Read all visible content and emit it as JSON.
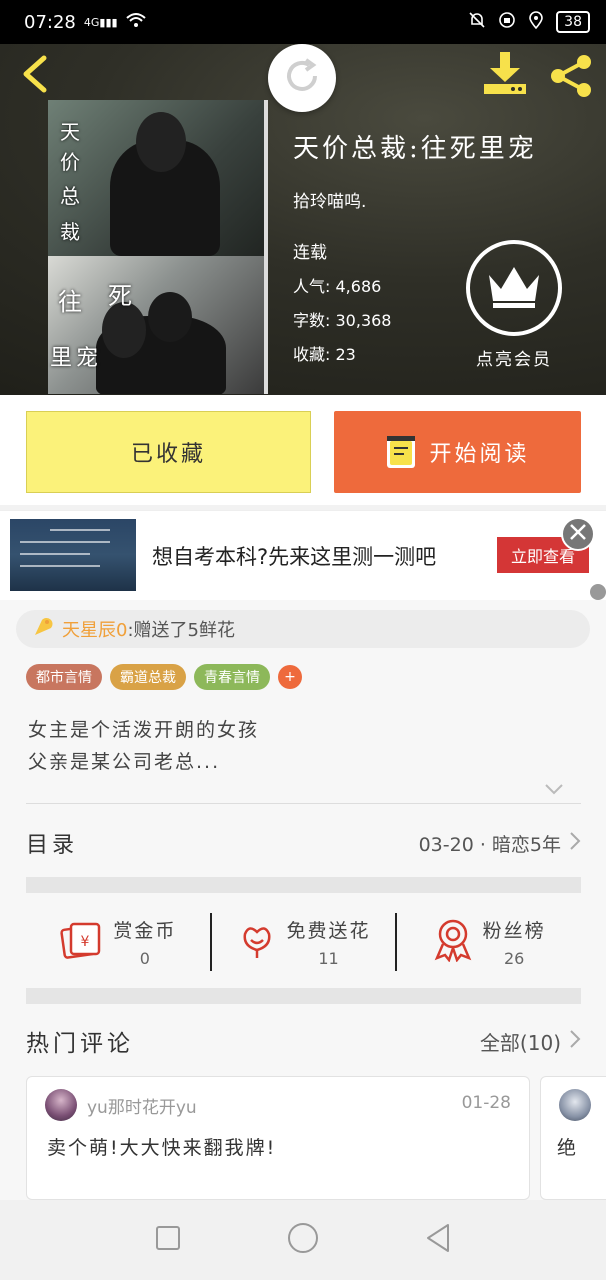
{
  "status_bar": {
    "time": "07:28",
    "network": "4G",
    "battery": "38",
    "icons": [
      "signal-icon",
      "wifi-icon",
      "mute-icon",
      "alarm-icon",
      "location-icon",
      "battery-icon"
    ]
  },
  "book": {
    "title": "天价总裁:往死里宠",
    "author": "拾玲喵呜.",
    "status": "连载",
    "popularity_label": "人气:",
    "popularity": "4,686",
    "words_label": "字数:",
    "words": "30,368",
    "favorites_label": "收藏:",
    "favorites": "23",
    "vip_label": "点亮会员",
    "cover_text": [
      "天",
      "价",
      "总",
      "裁",
      "往",
      "死",
      "里",
      "宠"
    ]
  },
  "actions": {
    "collected_label": "已收藏",
    "read_label": "开始阅读"
  },
  "ad": {
    "text": "想自考本科?先来这里测一测吧",
    "cta": "立即查看"
  },
  "gift": {
    "user": "天星辰0",
    "message": ":赠送了5鲜花"
  },
  "tags": [
    {
      "label": "都市言情",
      "color": "#c8765f"
    },
    {
      "label": "霸道总裁",
      "color": "#d9a246"
    },
    {
      "label": "青春言情",
      "color": "#8db85a"
    }
  ],
  "tag_more": "+",
  "synopsis": {
    "line1": "女主是个活泼开朗的女孩",
    "line2": "父亲是某公司老总..."
  },
  "toc": {
    "title": "目录",
    "latest": "03-20 · 暗恋5年"
  },
  "support": [
    {
      "label": "赏金币",
      "count": "0",
      "icon": "coin-ticket-icon"
    },
    {
      "label": "免费送花",
      "count": "11",
      "icon": "flower-icon"
    },
    {
      "label": "粉丝榜",
      "count": "26",
      "icon": "ribbon-medal-icon"
    }
  ],
  "comments": {
    "title": "热门评论",
    "all": "全部(10)",
    "items": [
      {
        "user": "yu那时花开yu",
        "date": "01-28",
        "body": "卖个萌!大大快来翻我牌!"
      },
      {
        "body": "绝"
      }
    ]
  },
  "colors": {
    "accent_orange": "#ee6a3c",
    "collected_yellow": "#fbf27a",
    "icon_yellow": "#f7e14b",
    "ad_red": "#d43636"
  }
}
